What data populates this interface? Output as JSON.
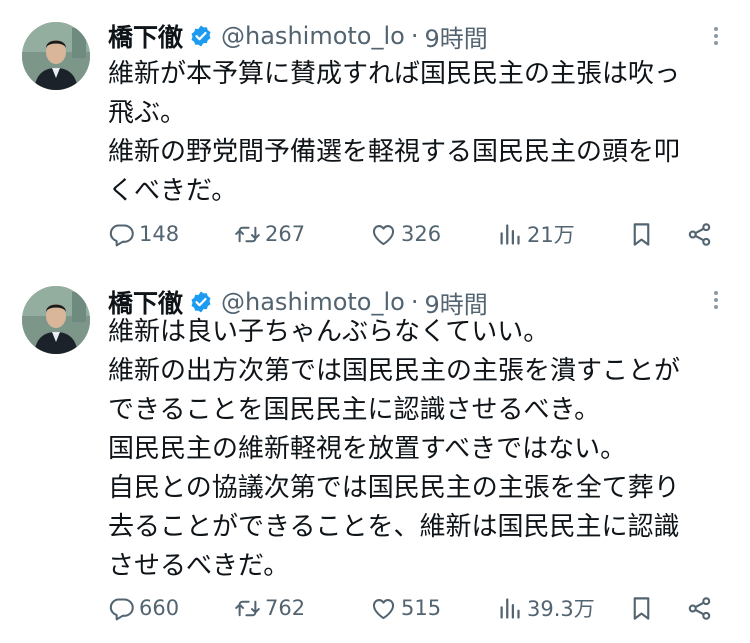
{
  "tweets": [
    {
      "author": {
        "name": "橋下徹",
        "handle": "@hashimoto_lo",
        "separator": "·",
        "time": "9時間"
      },
      "lines": [
        "維新が本予算に賛成すれば国民民主の主張は吹っ",
        "飛ぶ。",
        "維新の野党間予備選を軽視する国民民主の頭を叩",
        "くべきだ。"
      ],
      "stats": {
        "replies": "148",
        "reposts": "267",
        "likes": "326",
        "views": "21万"
      }
    },
    {
      "author": {
        "name": "橋下徹",
        "handle": "@hashimoto_lo",
        "separator": "·",
        "time": "9時間"
      },
      "lines": [
        "維新は良い子ちゃんぶらなくていい。",
        "維新の出方次第では国民民主の主張を潰すことが",
        "できることを国民民主に認識させるべき。",
        "国民民主の維新軽視を放置すべきではない。",
        "自民との協議次第では国民民主の主張を全て葬り",
        "去ることができることを、維新は国民民主に認識",
        "させるべきだ。"
      ],
      "stats": {
        "replies": "660",
        "reposts": "762",
        "likes": "515",
        "views": "39.3万"
      }
    }
  ],
  "colors": {
    "text": "#0f1419",
    "secondary": "#536471",
    "verified": "#1d9bf0"
  },
  "icons": [
    "verified-badge-icon",
    "more-options-icon",
    "reply-icon",
    "repost-icon",
    "like-icon",
    "views-icon",
    "bookmark-icon",
    "share-icon"
  ]
}
